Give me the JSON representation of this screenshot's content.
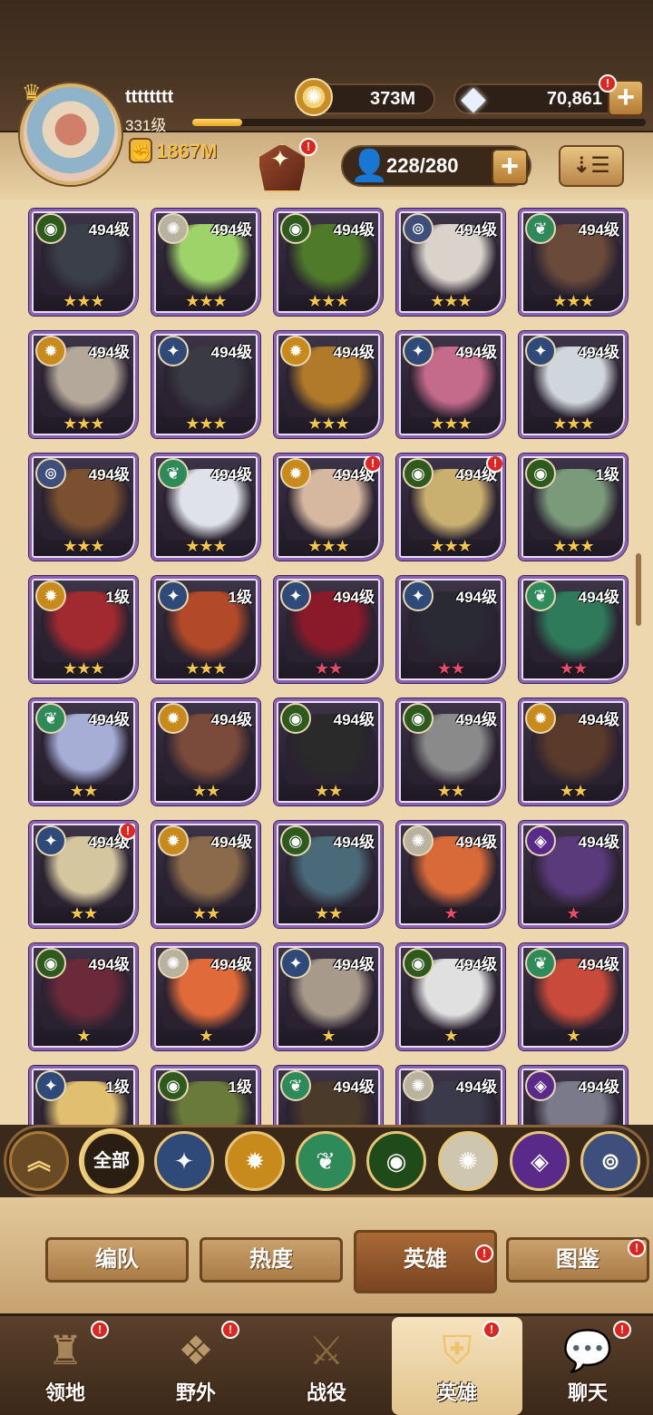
{
  "player": {
    "name": "tttttttt",
    "level": "331级",
    "xp_progress": 0.11,
    "power": "1867M"
  },
  "resources": {
    "coins": "373M",
    "gems": "70,861"
  },
  "heroes_count": "228/280",
  "colors": {
    "parchment": "#ecd7ae",
    "card_border": "#8b5fb6",
    "gold_star": "#f4c64a",
    "red_star": "#e84a6a",
    "badge": "#e0251f"
  },
  "factions": {
    "lightbearer": {
      "icon": "compass-star-icon",
      "color": "#2f4a78"
    },
    "mauler": {
      "icon": "flame-shield-icon",
      "color": "#c98a1c"
    },
    "wilder": {
      "icon": "leaf-icon",
      "color": "#2f8a5a"
    },
    "graveborn": {
      "icon": "eye-icon",
      "color": "#2e5a1e"
    },
    "celestial": {
      "icon": "sun-icon",
      "color": "#b9b2a0"
    },
    "hypogean": {
      "icon": "dark-crystal-icon",
      "color": "#5a2a8a"
    },
    "dimensional": {
      "icon": "dimension-icon",
      "color": "#3d4f7a"
    }
  },
  "heroes": [
    {
      "faction": "graveborn",
      "level": "494级",
      "stars": "★★★",
      "star_color": "gold",
      "portrait": "#3a3f4a",
      "badge": false
    },
    {
      "faction": "celestial",
      "level": "494级",
      "stars": "★★★",
      "star_color": "gold",
      "portrait": "#9ed36a",
      "badge": false
    },
    {
      "faction": "graveborn",
      "level": "494级",
      "stars": "★★★",
      "star_color": "gold",
      "portrait": "#4f7a2a",
      "badge": false
    },
    {
      "faction": "dimensional",
      "level": "494级",
      "stars": "★★★",
      "star_color": "gold",
      "portrait": "#d9d3cc",
      "badge": false
    },
    {
      "faction": "wilder",
      "level": "494级",
      "stars": "★★★",
      "star_color": "gold",
      "portrait": "#6a4a3a",
      "badge": false
    },
    {
      "faction": "mauler",
      "level": "494级",
      "stars": "★★★",
      "star_color": "gold",
      "portrait": "#b4a89a",
      "badge": false
    },
    {
      "faction": "lightbearer",
      "level": "494级",
      "stars": "★★★",
      "star_color": "gold",
      "portrait": "#3a3a44",
      "badge": false
    },
    {
      "faction": "mauler",
      "level": "494级",
      "stars": "★★★",
      "star_color": "gold",
      "portrait": "#b07a2a",
      "badge": false
    },
    {
      "faction": "lightbearer",
      "level": "494级",
      "stars": "★★★",
      "star_color": "gold",
      "portrait": "#c46a8a",
      "badge": false
    },
    {
      "faction": "lightbearer",
      "level": "494级",
      "stars": "★★★",
      "star_color": "gold",
      "portrait": "#cfd6dc",
      "badge": false
    },
    {
      "faction": "dimensional",
      "level": "494级",
      "stars": "★★★",
      "star_color": "gold",
      "portrait": "#7a5030",
      "badge": false
    },
    {
      "faction": "wilder",
      "level": "494级",
      "stars": "★★★",
      "star_color": "gold",
      "portrait": "#dfe2ea",
      "badge": false
    },
    {
      "faction": "mauler",
      "level": "494级",
      "stars": "★★★",
      "star_color": "gold",
      "portrait": "#d6b8a0",
      "badge": true
    },
    {
      "faction": "graveborn",
      "level": "494级",
      "stars": "★★★",
      "star_color": "gold",
      "portrait": "#c9b070",
      "badge": true
    },
    {
      "faction": "graveborn",
      "level": "1级",
      "stars": "★★★",
      "star_color": "gold",
      "portrait": "#7a9a7a",
      "badge": false
    },
    {
      "faction": "mauler",
      "level": "1级",
      "stars": "★★★",
      "star_color": "gold",
      "portrait": "#a02a30",
      "badge": false
    },
    {
      "faction": "lightbearer",
      "level": "1级",
      "stars": "★★★",
      "star_color": "gold",
      "portrait": "#b24a2a",
      "badge": false
    },
    {
      "faction": "lightbearer",
      "level": "494级",
      "stars": "★★",
      "star_color": "red",
      "portrait": "#8a1a2a",
      "badge": false
    },
    {
      "faction": "lightbearer",
      "level": "494级",
      "stars": "★★",
      "star_color": "red",
      "portrait": "#2a2a34",
      "badge": false
    },
    {
      "faction": "wilder",
      "level": "494级",
      "stars": "★★",
      "star_color": "red",
      "portrait": "#2e7a5a",
      "badge": false
    },
    {
      "faction": "wilder",
      "level": "494级",
      "stars": "★★",
      "star_color": "gold",
      "portrait": "#a6aed6",
      "badge": false
    },
    {
      "faction": "mauler",
      "level": "494级",
      "stars": "★★",
      "star_color": "gold",
      "portrait": "#7a4a3a",
      "badge": false
    },
    {
      "faction": "graveborn",
      "level": "494级",
      "stars": "★★",
      "star_color": "gold",
      "portrait": "#2a2a2a",
      "badge": false
    },
    {
      "faction": "graveborn",
      "level": "494级",
      "stars": "★★",
      "star_color": "gold",
      "portrait": "#8a8a8a",
      "badge": false
    },
    {
      "faction": "mauler",
      "level": "494级",
      "stars": "★★",
      "star_color": "gold",
      "portrait": "#5a3a2a",
      "badge": false
    },
    {
      "faction": "lightbearer",
      "level": "494级",
      "stars": "★★",
      "star_color": "gold",
      "portrait": "#d4c7a0",
      "badge": true
    },
    {
      "faction": "mauler",
      "level": "494级",
      "stars": "★★",
      "star_color": "gold",
      "portrait": "#8a6a4a",
      "badge": false
    },
    {
      "faction": "graveborn",
      "level": "494级",
      "stars": "★★",
      "star_color": "gold",
      "portrait": "#4a6a7a",
      "badge": false
    },
    {
      "faction": "celestial",
      "level": "494级",
      "stars": "★",
      "star_color": "red",
      "portrait": "#d86a3a",
      "badge": false
    },
    {
      "faction": "hypogean",
      "level": "494级",
      "stars": "★",
      "star_color": "red",
      "portrait": "#5a3a7a",
      "badge": false
    },
    {
      "faction": "graveborn",
      "level": "494级",
      "stars": "★",
      "star_color": "gold",
      "portrait": "#6a2a3a",
      "badge": false
    },
    {
      "faction": "celestial",
      "level": "494级",
      "stars": "★",
      "star_color": "gold",
      "portrait": "#e06a3a",
      "badge": false
    },
    {
      "faction": "lightbearer",
      "level": "494级",
      "stars": "★",
      "star_color": "gold",
      "portrait": "#a89a8a",
      "badge": false
    },
    {
      "faction": "graveborn",
      "level": "494级",
      "stars": "★",
      "star_color": "gold",
      "portrait": "#e0e0e0",
      "badge": false
    },
    {
      "faction": "wilder",
      "level": "494级",
      "stars": "★",
      "star_color": "gold",
      "portrait": "#c84a3a",
      "badge": false
    },
    {
      "faction": "lightbearer",
      "level": "1级",
      "stars": "",
      "star_color": "gold",
      "portrait": "#e0c070",
      "badge": false
    },
    {
      "faction": "graveborn",
      "level": "1级",
      "stars": "",
      "star_color": "gold",
      "portrait": "#6a7a3a",
      "badge": false
    },
    {
      "faction": "wilder",
      "level": "494级",
      "stars": "",
      "star_color": "gold",
      "portrait": "#4a3a2a",
      "badge": false
    },
    {
      "faction": "celestial",
      "level": "494级",
      "stars": "",
      "star_color": "gold",
      "portrait": "#3a3a4a",
      "badge": false
    },
    {
      "faction": "hypogean",
      "level": "494级",
      "stars": "",
      "star_color": "gold",
      "portrait": "#7a7a8a",
      "badge": false
    }
  ],
  "faction_filters": [
    {
      "name": "scroll-up",
      "label": "",
      "icon": "double-chevron-up-icon"
    },
    {
      "name": "all",
      "label": "全部",
      "icon": ""
    },
    {
      "name": "lightbearer",
      "label": "",
      "icon": "compass-star-icon"
    },
    {
      "name": "mauler",
      "label": "",
      "icon": "flame-shield-icon"
    },
    {
      "name": "wilder",
      "label": "",
      "icon": "leaf-icon"
    },
    {
      "name": "graveborn",
      "label": "",
      "icon": "eye-icon"
    },
    {
      "name": "celestial",
      "label": "",
      "icon": "sun-icon"
    },
    {
      "name": "hypogean",
      "label": "",
      "icon": "dark-crystal-icon"
    },
    {
      "name": "dimensional",
      "label": "",
      "icon": "dimension-icon"
    }
  ],
  "sub_tabs": [
    {
      "label": "编队",
      "active": false,
      "badge": false
    },
    {
      "label": "热度",
      "active": false,
      "badge": false
    },
    {
      "label": "英雄",
      "active": true,
      "badge": true
    },
    {
      "label": "图鉴",
      "active": false,
      "badge": true
    }
  ],
  "nav": [
    {
      "label": "领地",
      "icon": "castle-icon",
      "active": false,
      "badge": true
    },
    {
      "label": "野外",
      "icon": "map-scroll-icon",
      "active": false,
      "badge": true
    },
    {
      "label": "战役",
      "icon": "sword-crest-icon",
      "active": false,
      "badge": false
    },
    {
      "label": "英雄",
      "icon": "helmet-icon",
      "active": true,
      "badge": true
    },
    {
      "label": "聊天",
      "icon": "chat-bubble-icon",
      "active": false,
      "badge": true
    }
  ]
}
